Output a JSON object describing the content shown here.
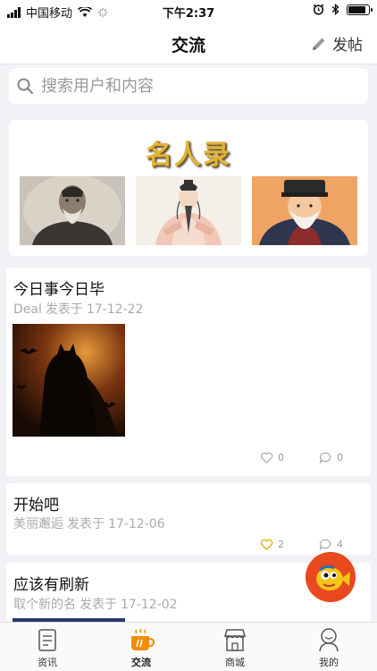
{
  "status_bar": {
    "carrier": "中国移动",
    "time": "下午2:37"
  },
  "nav": {
    "title": "交流",
    "post_label": "发帖"
  },
  "search": {
    "placeholder": "搜索用户和内容"
  },
  "banner": {
    "title": "名人录",
    "portraits": [
      "portrait-elder-photo",
      "portrait-ancient-scholar",
      "portrait-sage-with-hat"
    ]
  },
  "posts": [
    {
      "title": "今日事今日毕",
      "author": "Deal",
      "posted_label": "发表于",
      "date": "17-12-22",
      "image": "batman-silhouette",
      "likes": "0",
      "comments": "0"
    },
    {
      "title": "开始吧",
      "author": "美丽邂逅",
      "posted_label": "发表于",
      "date": "17-12-06",
      "likes": "2",
      "comments": "4"
    },
    {
      "title": "应该有刷新",
      "author": "取个新的名",
      "posted_label": "发表于",
      "date": "17-12-02"
    }
  ],
  "tabs": [
    {
      "label": "资讯",
      "icon": "document-icon"
    },
    {
      "label": "交流",
      "icon": "coffee-cup-icon"
    },
    {
      "label": "商城",
      "icon": "store-icon"
    },
    {
      "label": "我的",
      "icon": "user-icon"
    }
  ],
  "colors": {
    "accent": "#f08c00",
    "fab": "#e8491f",
    "like_active": "#f0a800"
  }
}
